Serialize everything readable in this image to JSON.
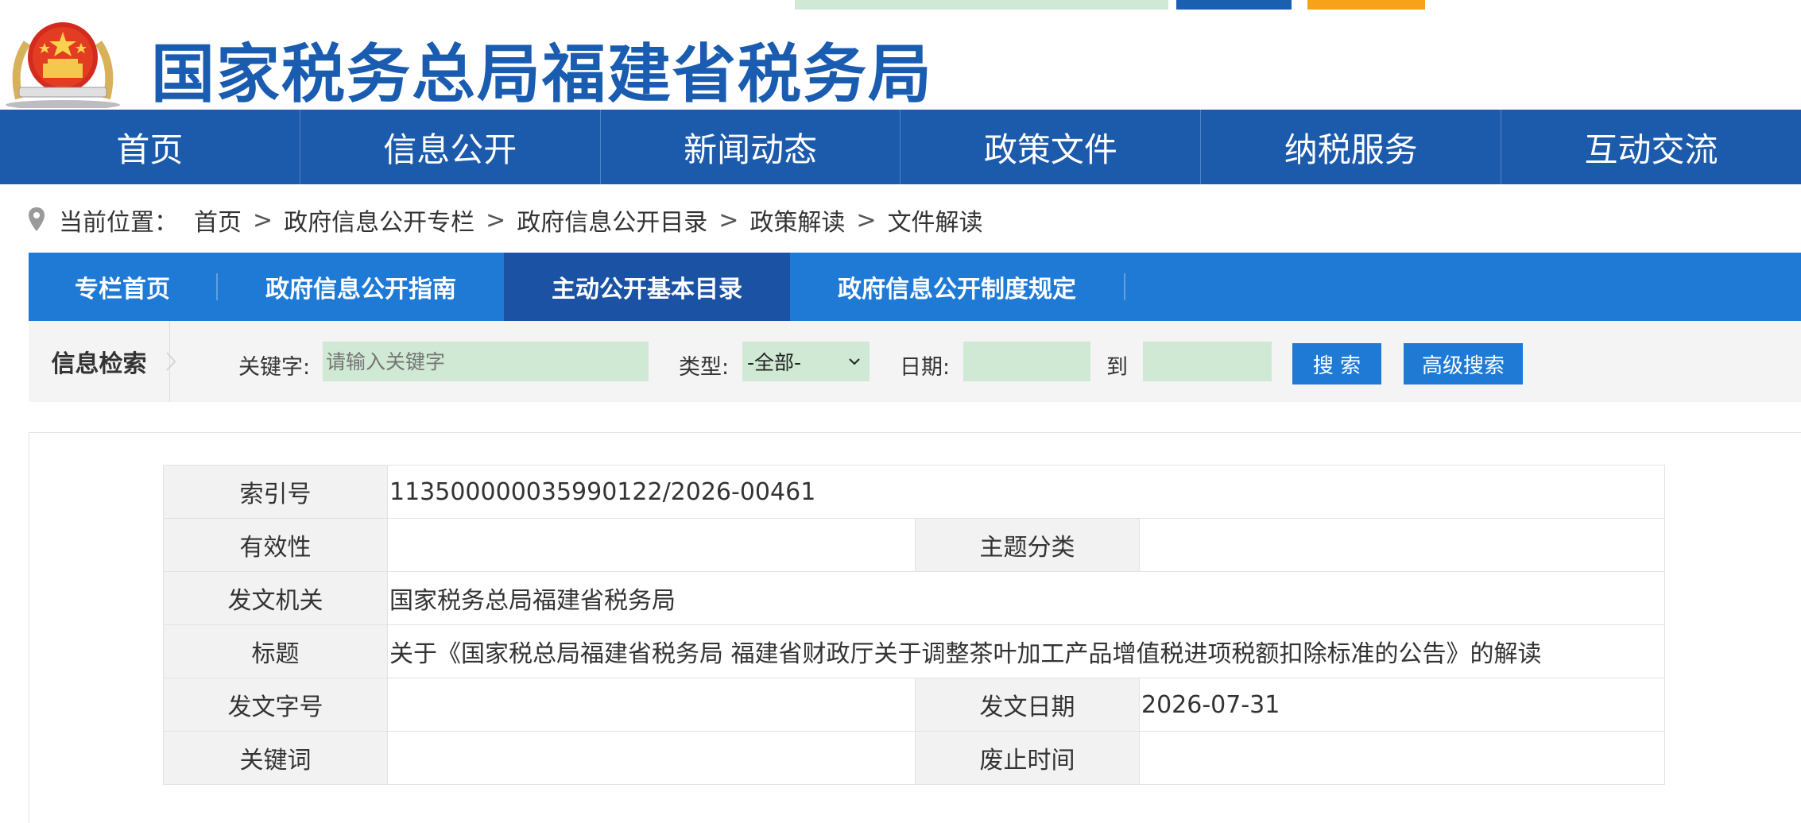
{
  "header": {
    "site_title": "国家税务总局福建省税务局",
    "emblem_icon": "national-emblem-icon"
  },
  "nav": {
    "items": [
      "首页",
      "信息公开",
      "新闻动态",
      "政策文件",
      "纳税服务",
      "互动交流"
    ]
  },
  "breadcrumb": {
    "prefix": "当前位置：",
    "items": [
      "首页",
      "政府信息公开专栏",
      "政府信息公开目录",
      "政策解读",
      "文件解读"
    ],
    "separator": ">"
  },
  "subtabs": {
    "items": [
      "专栏首页",
      "政府信息公开指南",
      "主动公开基本目录",
      "政府信息公开制度规定"
    ],
    "active_index": 2
  },
  "search": {
    "section_label": "信息检索",
    "keyword_label": "关键字:",
    "keyword_placeholder": "请输入关键字",
    "type_label": "类型:",
    "type_value": "-全部-",
    "date_label": "日期:",
    "to_label": "到",
    "search_button": "搜 索",
    "advanced_button": "高级搜索"
  },
  "meta": {
    "index_label": "索引号",
    "index_value": "113500000035990122/2026-00461",
    "validity_label": "有效性",
    "validity_value": "",
    "topic_label": "主题分类",
    "topic_value": "",
    "issuer_label": "发文机关",
    "issuer_value": "国家税务总局福建省税务局",
    "title_label": "标题",
    "title_value": "关于《国家税总局福建省税务局 福建省财政厅关于调整茶叶加工产品增值税进项税额扣除标准的公告》的解读",
    "docno_label": "发文字号",
    "docno_value": "",
    "date_label": "发文日期",
    "date_value": "2026-07-31",
    "keywords_label": "关键词",
    "keywords_value": "",
    "abolish_label": "废止时间",
    "abolish_value": ""
  },
  "colors": {
    "nav_bg": "#1c5aab",
    "subtab_bg": "#1f7ad6",
    "subtab_active": "#1b52a3",
    "input_bg": "#cfe9d4",
    "title_blue": "#1a5cb0"
  }
}
